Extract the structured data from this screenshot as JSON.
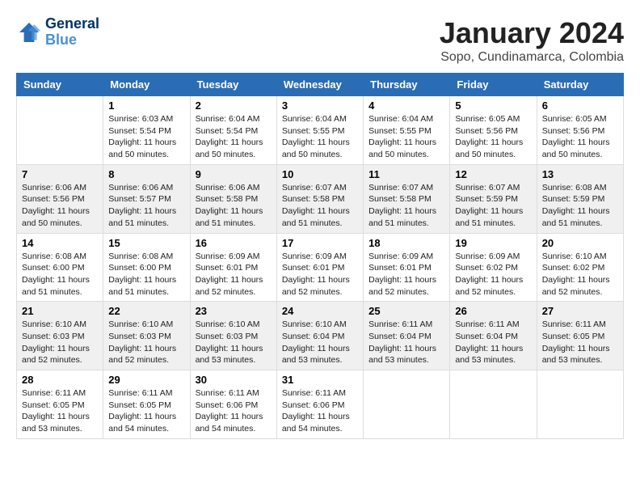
{
  "header": {
    "logo_line1": "General",
    "logo_line2": "Blue",
    "title": "January 2024",
    "subtitle": "Sopo, Cundinamarca, Colombia"
  },
  "calendar": {
    "days_of_week": [
      "Sunday",
      "Monday",
      "Tuesday",
      "Wednesday",
      "Thursday",
      "Friday",
      "Saturday"
    ],
    "weeks": [
      [
        {
          "day": "",
          "info": ""
        },
        {
          "day": "1",
          "info": "Sunrise: 6:03 AM\nSunset: 5:54 PM\nDaylight: 11 hours\nand 50 minutes."
        },
        {
          "day": "2",
          "info": "Sunrise: 6:04 AM\nSunset: 5:54 PM\nDaylight: 11 hours\nand 50 minutes."
        },
        {
          "day": "3",
          "info": "Sunrise: 6:04 AM\nSunset: 5:55 PM\nDaylight: 11 hours\nand 50 minutes."
        },
        {
          "day": "4",
          "info": "Sunrise: 6:04 AM\nSunset: 5:55 PM\nDaylight: 11 hours\nand 50 minutes."
        },
        {
          "day": "5",
          "info": "Sunrise: 6:05 AM\nSunset: 5:56 PM\nDaylight: 11 hours\nand 50 minutes."
        },
        {
          "day": "6",
          "info": "Sunrise: 6:05 AM\nSunset: 5:56 PM\nDaylight: 11 hours\nand 50 minutes."
        }
      ],
      [
        {
          "day": "7",
          "info": "Sunrise: 6:06 AM\nSunset: 5:56 PM\nDaylight: 11 hours\nand 50 minutes."
        },
        {
          "day": "8",
          "info": "Sunrise: 6:06 AM\nSunset: 5:57 PM\nDaylight: 11 hours\nand 51 minutes."
        },
        {
          "day": "9",
          "info": "Sunrise: 6:06 AM\nSunset: 5:58 PM\nDaylight: 11 hours\nand 51 minutes."
        },
        {
          "day": "10",
          "info": "Sunrise: 6:07 AM\nSunset: 5:58 PM\nDaylight: 11 hours\nand 51 minutes."
        },
        {
          "day": "11",
          "info": "Sunrise: 6:07 AM\nSunset: 5:58 PM\nDaylight: 11 hours\nand 51 minutes."
        },
        {
          "day": "12",
          "info": "Sunrise: 6:07 AM\nSunset: 5:59 PM\nDaylight: 11 hours\nand 51 minutes."
        },
        {
          "day": "13",
          "info": "Sunrise: 6:08 AM\nSunset: 5:59 PM\nDaylight: 11 hours\nand 51 minutes."
        }
      ],
      [
        {
          "day": "14",
          "info": "Sunrise: 6:08 AM\nSunset: 6:00 PM\nDaylight: 11 hours\nand 51 minutes."
        },
        {
          "day": "15",
          "info": "Sunrise: 6:08 AM\nSunset: 6:00 PM\nDaylight: 11 hours\nand 51 minutes."
        },
        {
          "day": "16",
          "info": "Sunrise: 6:09 AM\nSunset: 6:01 PM\nDaylight: 11 hours\nand 52 minutes."
        },
        {
          "day": "17",
          "info": "Sunrise: 6:09 AM\nSunset: 6:01 PM\nDaylight: 11 hours\nand 52 minutes."
        },
        {
          "day": "18",
          "info": "Sunrise: 6:09 AM\nSunset: 6:01 PM\nDaylight: 11 hours\nand 52 minutes."
        },
        {
          "day": "19",
          "info": "Sunrise: 6:09 AM\nSunset: 6:02 PM\nDaylight: 11 hours\nand 52 minutes."
        },
        {
          "day": "20",
          "info": "Sunrise: 6:10 AM\nSunset: 6:02 PM\nDaylight: 11 hours\nand 52 minutes."
        }
      ],
      [
        {
          "day": "21",
          "info": "Sunrise: 6:10 AM\nSunset: 6:03 PM\nDaylight: 11 hours\nand 52 minutes."
        },
        {
          "day": "22",
          "info": "Sunrise: 6:10 AM\nSunset: 6:03 PM\nDaylight: 11 hours\nand 52 minutes."
        },
        {
          "day": "23",
          "info": "Sunrise: 6:10 AM\nSunset: 6:03 PM\nDaylight: 11 hours\nand 53 minutes."
        },
        {
          "day": "24",
          "info": "Sunrise: 6:10 AM\nSunset: 6:04 PM\nDaylight: 11 hours\nand 53 minutes."
        },
        {
          "day": "25",
          "info": "Sunrise: 6:11 AM\nSunset: 6:04 PM\nDaylight: 11 hours\nand 53 minutes."
        },
        {
          "day": "26",
          "info": "Sunrise: 6:11 AM\nSunset: 6:04 PM\nDaylight: 11 hours\nand 53 minutes."
        },
        {
          "day": "27",
          "info": "Sunrise: 6:11 AM\nSunset: 6:05 PM\nDaylight: 11 hours\nand 53 minutes."
        }
      ],
      [
        {
          "day": "28",
          "info": "Sunrise: 6:11 AM\nSunset: 6:05 PM\nDaylight: 11 hours\nand 53 minutes."
        },
        {
          "day": "29",
          "info": "Sunrise: 6:11 AM\nSunset: 6:05 PM\nDaylight: 11 hours\nand 54 minutes."
        },
        {
          "day": "30",
          "info": "Sunrise: 6:11 AM\nSunset: 6:06 PM\nDaylight: 11 hours\nand 54 minutes."
        },
        {
          "day": "31",
          "info": "Sunrise: 6:11 AM\nSunset: 6:06 PM\nDaylight: 11 hours\nand 54 minutes."
        },
        {
          "day": "",
          "info": ""
        },
        {
          "day": "",
          "info": ""
        },
        {
          "day": "",
          "info": ""
        }
      ]
    ]
  }
}
